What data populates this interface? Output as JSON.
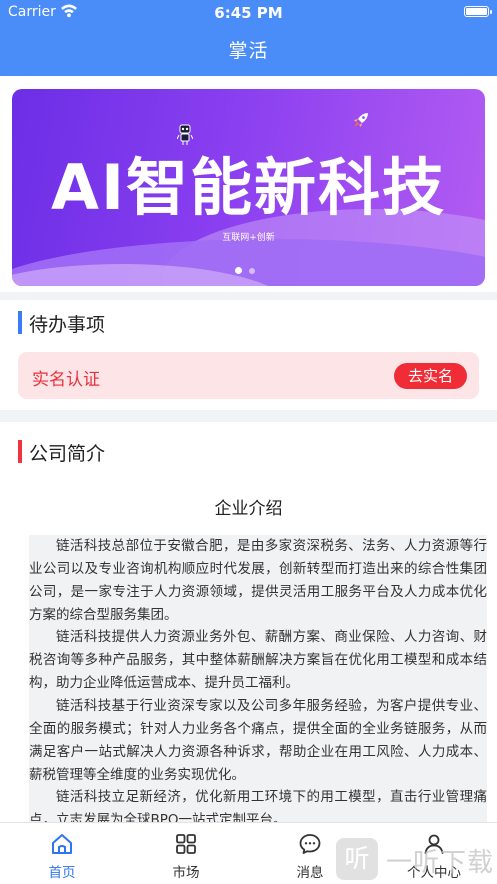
{
  "status_bar": {
    "carrier": "Carrier",
    "time": "6:45 PM"
  },
  "header": {
    "title": "掌活"
  },
  "banner": {
    "headline": "AI智能新科技",
    "subtitle": "互联网+创新",
    "page_count": 2,
    "active_index": 0
  },
  "todo": {
    "title": "待办事项",
    "accent_color": "#3a7cf5",
    "item": {
      "label": "实名认证",
      "button": "去实名"
    }
  },
  "company": {
    "title": "公司简介",
    "accent_color": "#f0333c",
    "heading": "企业介绍",
    "paragraphs": [
      "链活科技总部位于安徽合肥，是由多家资深税务、法务、人力资源等行业公司以及专业咨询机构顺应时代发展，创新转型而打造出来的综合性集团公司，是一家专注于人力资源领域，提供灵活用工服务平台及人力成本优化方案的综合型服务集团。",
      "链活科技提供人力资源业务外包、薪酬方案、商业保险、人力咨询、财税咨询等多种产品服务，其中整体薪酬解决方案旨在优化用工模型和成本结构，助力企业降低运营成本、提升员工福利。",
      "链活科技基于行业资深专家以及公司多年服务经验，为客户提供专业、全面的服务模式；针对人力业务各个痛点，提供全面的全业务链服务，从而满足客户一站式解决人力资源各种诉求，帮助企业在用工风险、人力成本、薪税管理等全维度的业务实现优化。",
      "链活科技立足新经济，优化新用工环境下的用工模型，直击行业管理痛点，立志发展为全球BPO一站式定制平台。"
    ]
  },
  "tabbar": {
    "active_color": "#2f74f0",
    "tabs": [
      {
        "label": "首页",
        "icon": "home-icon",
        "active": true
      },
      {
        "label": "市场",
        "icon": "grid-icon",
        "active": false
      },
      {
        "label": "消息",
        "icon": "message-icon",
        "active": false
      },
      {
        "label": "个人中心",
        "icon": "user-icon",
        "active": false
      }
    ]
  },
  "watermark": {
    "glyph": "听",
    "text": "一听下载"
  }
}
